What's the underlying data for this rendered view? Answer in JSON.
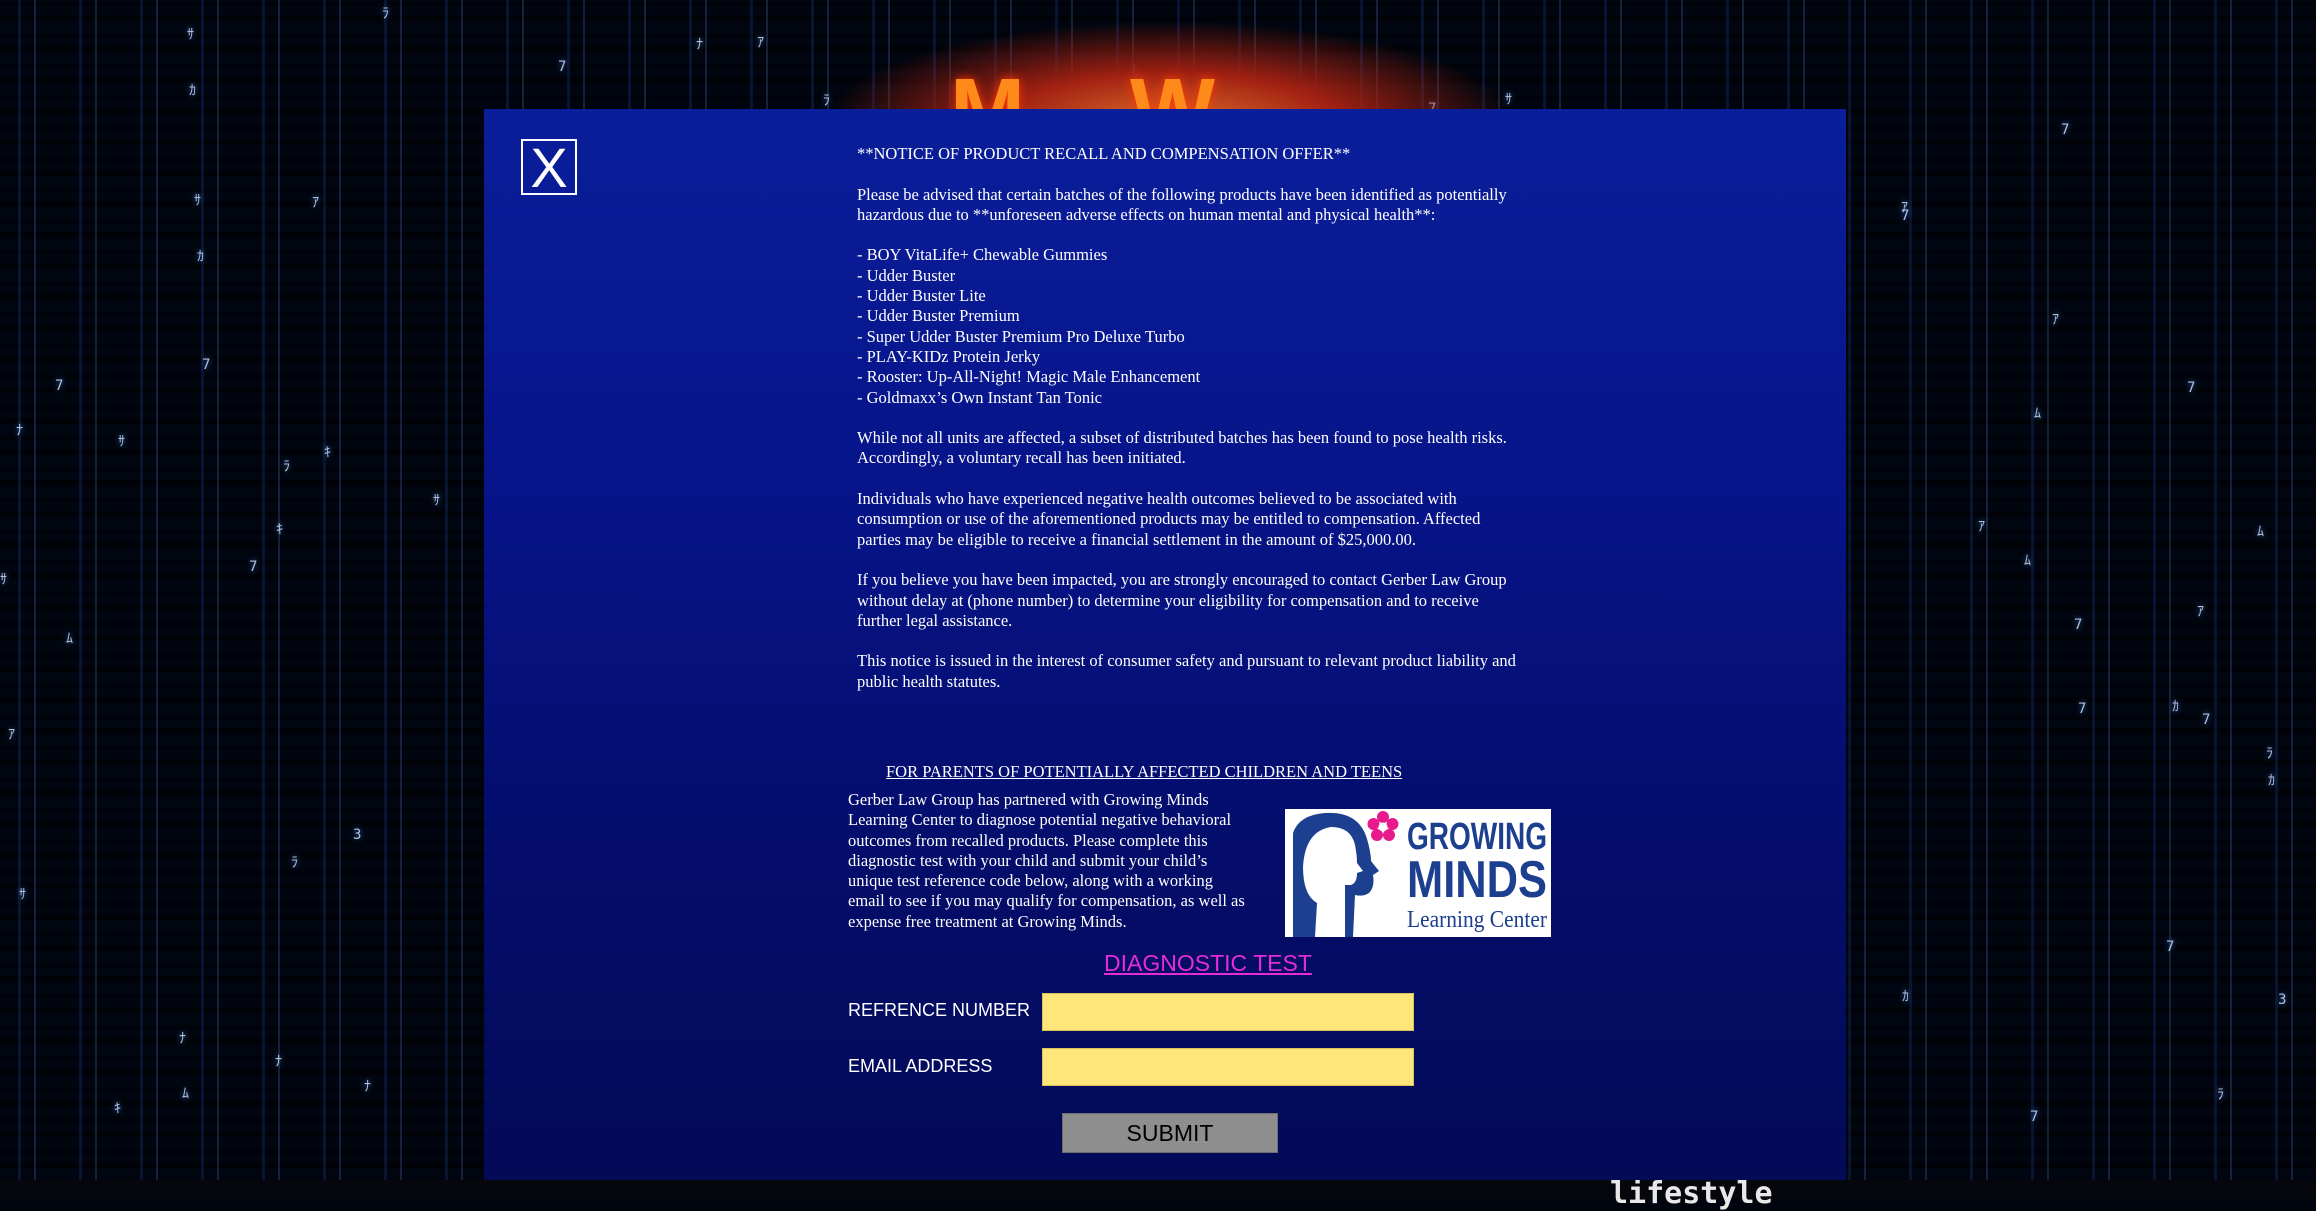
{
  "background": {
    "footer_text": "lifestyle"
  },
  "modal": {
    "close_label": "X",
    "notice_title": "**NOTICE OF PRODUCT RECALL AND COMPENSATION OFFER**",
    "intro": "Please be advised that certain batches of the following products have been identified as potentially hazardous due to **unforeseen adverse effects on human mental and physical health**:",
    "products": [
      "- BOY VitaLife+ Chewable Gummies",
      "- Udder Buster",
      "- Udder Buster Lite",
      "- Udder Buster Premium",
      "- Super Udder Buster Premium Pro Deluxe Turbo",
      "- PLAY-KIDz Protein Jerky",
      "- Rooster: Up-All-Night! Magic Male Enhancement",
      "- Goldmaxx’s Own Instant Tan Tonic"
    ],
    "para_recall": "While not all units are affected, a subset of distributed batches has been found to pose health risks. Accordingly, a voluntary recall has been initiated.",
    "para_compensation": "Individuals who have experienced negative health outcomes believed to be associated with consumption or use of the aforementioned products may be entitled to compensation. Affected parties may be eligible to receive a financial settlement in the amount of $25,000.00.",
    "para_contact": "If you believe you have been impacted, you are strongly encouraged to contact Gerber Law Group without delay at (phone number)  to determine your eligibility for compensation and to receive further legal assistance.",
    "para_statute": "This notice is issued in the interest of consumer safety and pursuant to relevant product liability and public health statutes.",
    "parents_heading": "FOR PARENTS OF POTENTIALLY AFFECTED CHILDREN AND TEENS",
    "parents_text": "Gerber Law Group has partnered with Growing Minds Learning Center to diagnose potential negative behavioral outcomes from recalled products. Please complete this diagnostic test with your child and submit your child’s unique test reference code below, along with a working email to see if you may qualify for compensation, as well as expense free treatment at Growing Minds.",
    "logo": {
      "line1": "GROWING",
      "line2": "MINDS",
      "line3": "Learning Center"
    },
    "diagnostic_link": "DIAGNOSTIC TEST",
    "reference_label": "REFRENCE NUMBER",
    "reference_value": "",
    "email_label": "EMAIL ADDRESS",
    "email_value": "",
    "submit_label": "SUBMIT"
  },
  "colors": {
    "modal_bg": "#07148a",
    "link": "#e62bd8",
    "input_bg": "#fde77a",
    "button_bg": "#8e8e8e"
  }
}
